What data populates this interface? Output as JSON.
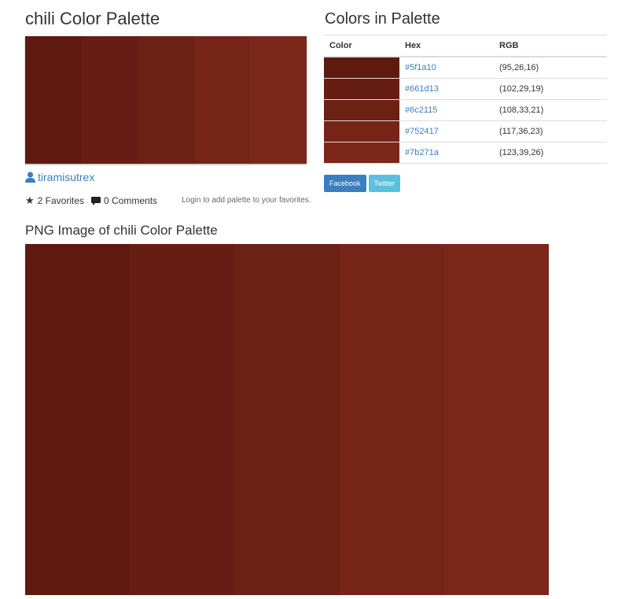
{
  "page_title": "chili Color Palette",
  "author": "tiramisutrex",
  "stats": {
    "favorites": "2 Favorites",
    "comments": "0 Comments"
  },
  "login_note": "Login to add palette to your favorites.",
  "colors_section": {
    "title": "Colors in Palette",
    "headers": {
      "color": "Color",
      "hex": "Hex",
      "rgb": "RGB"
    },
    "rows": [
      {
        "hex": "#5f1a10",
        "rgb": "(95,26,16)",
        "swatch": "#5f1a10"
      },
      {
        "hex": "#661d13",
        "rgb": "(102,29,19)",
        "swatch": "#661d13"
      },
      {
        "hex": "#6c2115",
        "rgb": "(108,33,21)",
        "swatch": "#6c2115"
      },
      {
        "hex": "#752417",
        "rgb": "(117,36,23)",
        "swatch": "#752417"
      },
      {
        "hex": "#7b271a",
        "rgb": "(123,39,26)",
        "swatch": "#7b271a"
      }
    ]
  },
  "share": {
    "facebook": "Facebook",
    "twitter": "Twitter"
  },
  "png_section": {
    "title": "PNG Image of chili Color Palette"
  },
  "icons": {
    "author": "user-icon",
    "favorites": "star-icon",
    "comments": "comment-icon"
  }
}
